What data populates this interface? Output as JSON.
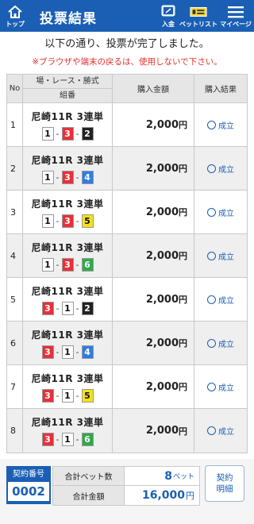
{
  "header": {
    "title": "投票結果",
    "nav": {
      "top": "トップ",
      "deposit": "入金",
      "betlist": "ベットリスト",
      "mypage": "マイページ"
    }
  },
  "messages": {
    "line1": "以下の通り、投票が完了しました。",
    "warning": "※ブラウザや端末の戻るは、使用しないで下さい。"
  },
  "table": {
    "headers": {
      "no": "No",
      "race": "場・レース・勝式",
      "combo": "組番",
      "amount": "購入金額",
      "result": "購入結果"
    },
    "rows": [
      {
        "no": "1",
        "race": "尼崎11R 3連単",
        "n1": "1",
        "n2": "3",
        "n3": "2",
        "amount": "2,000",
        "yen": "円",
        "result": "成立"
      },
      {
        "no": "2",
        "race": "尼崎11R 3連単",
        "n1": "1",
        "n2": "3",
        "n3": "4",
        "amount": "2,000",
        "yen": "円",
        "result": "成立"
      },
      {
        "no": "3",
        "race": "尼崎11R 3連単",
        "n1": "1",
        "n2": "3",
        "n3": "5",
        "amount": "2,000",
        "yen": "円",
        "result": "成立"
      },
      {
        "no": "4",
        "race": "尼崎11R 3連単",
        "n1": "1",
        "n2": "3",
        "n3": "6",
        "amount": "2,000",
        "yen": "円",
        "result": "成立"
      },
      {
        "no": "5",
        "race": "尼崎11R 3連単",
        "n1": "3",
        "n2": "1",
        "n3": "2",
        "amount": "2,000",
        "yen": "円",
        "result": "成立"
      },
      {
        "no": "6",
        "race": "尼崎11R 3連単",
        "n1": "3",
        "n2": "1",
        "n3": "4",
        "amount": "2,000",
        "yen": "円",
        "result": "成立"
      },
      {
        "no": "7",
        "race": "尼崎11R 3連単",
        "n1": "3",
        "n2": "1",
        "n3": "5",
        "amount": "2,000",
        "yen": "円",
        "result": "成立"
      },
      {
        "no": "8",
        "race": "尼崎11R 3連単",
        "n1": "3",
        "n2": "1",
        "n3": "6",
        "amount": "2,000",
        "yen": "円",
        "result": "成立"
      }
    ]
  },
  "boat_colors": {
    "1": {
      "bg": "#ffffff",
      "fg": "#111111"
    },
    "2": {
      "bg": "#222222",
      "fg": "#ffffff"
    },
    "3": {
      "bg": "#e8303a",
      "fg": "#ffffff"
    },
    "4": {
      "bg": "#2f7de1",
      "fg": "#ffffff"
    },
    "5": {
      "bg": "#f5e11b",
      "fg": "#111111"
    },
    "6": {
      "bg": "#2eaa4a",
      "fg": "#ffffff"
    }
  },
  "footer": {
    "contract_label": "契約番号",
    "contract_no": "0002",
    "total_bets_label": "合計ベット数",
    "total_bets": "8",
    "total_bets_unit": "ベット",
    "total_amount_label": "合計金額",
    "total_amount": "16,000",
    "total_amount_unit": "円",
    "detail_line1": "契約",
    "detail_line2": "明細"
  },
  "accent_color": "#1a5fb4",
  "warning_color": "#e0302a",
  "icons": {
    "top": "home-icon",
    "deposit": "deposit-card-icon",
    "betlist": "ticket-icon",
    "mypage": "menu-icon",
    "result": "circle-icon"
  }
}
